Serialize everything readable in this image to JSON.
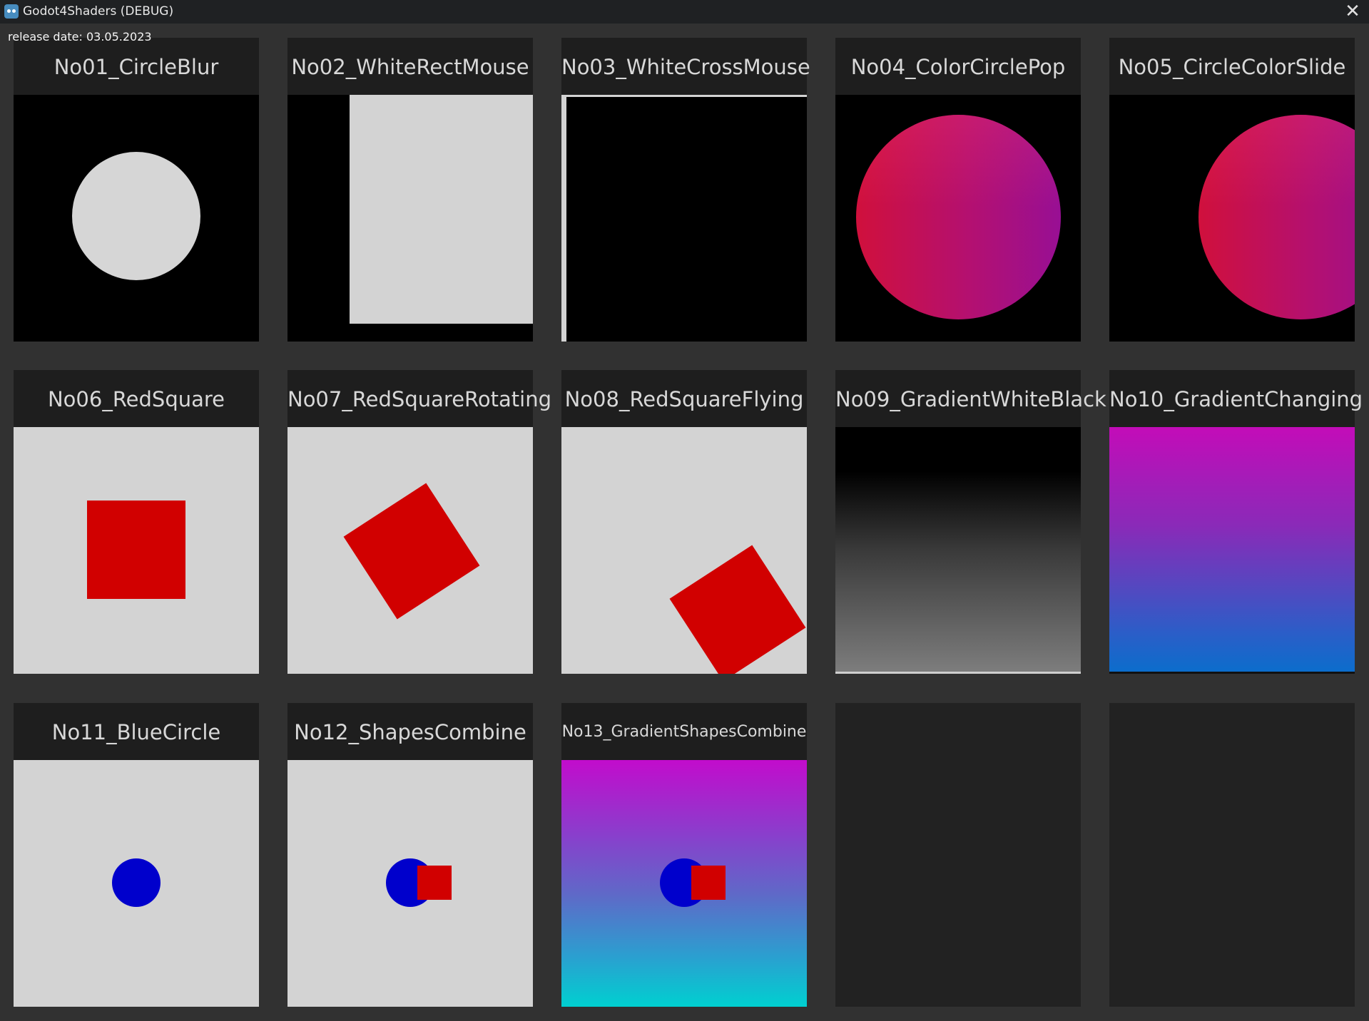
{
  "window": {
    "title": "Godot4Shaders (DEBUG)",
    "close_symbol": "✕"
  },
  "release_label": "release date: 03.05.2023",
  "shaders": [
    {
      "name": "No01_CircleBlur"
    },
    {
      "name": "No02_WhiteRectMouse"
    },
    {
      "name": "No03_WhiteCrossMouse"
    },
    {
      "name": "No04_ColorCirclePop"
    },
    {
      "name": "No05_CircleColorSlide"
    },
    {
      "name": "No06_RedSquare"
    },
    {
      "name": "No07_RedSquareRotating"
    },
    {
      "name": "No08_RedSquareFlying"
    },
    {
      "name": "No09_GradientWhiteBlack"
    },
    {
      "name": "No10_GradientChanging"
    },
    {
      "name": "No11_BlueCircle"
    },
    {
      "name": "No12_ShapesCombine"
    },
    {
      "name": "No13_GradientShapesCombine"
    }
  ],
  "colors": {
    "background": "#313131",
    "card": "#222222",
    "header": "#1e1e1e",
    "light_gray": "#d3d3d3",
    "red": "#d10000",
    "blue": "#0000cc",
    "magenta": "#c010c0",
    "cyan": "#00cfd0"
  }
}
